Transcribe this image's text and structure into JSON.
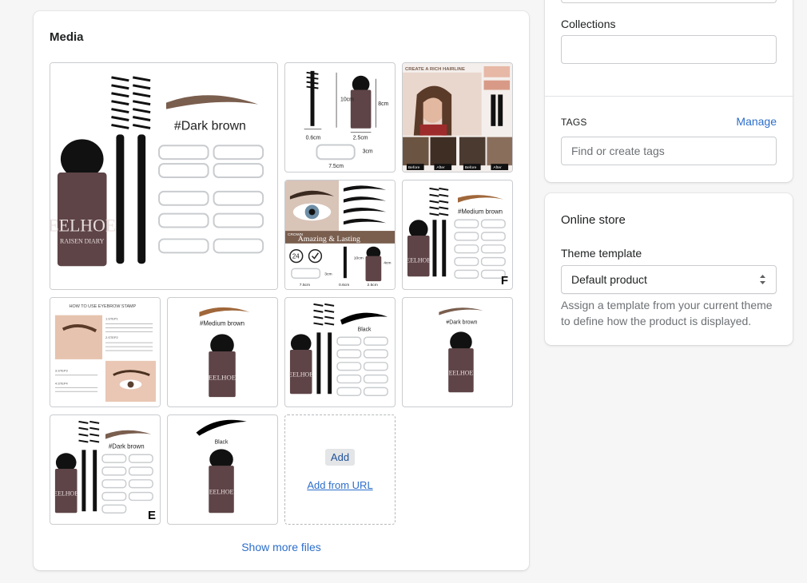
{
  "media": {
    "title": "Media",
    "images": [
      {
        "alt": "Eyebrow stamp kit #Dark brown",
        "label": "#Dark brown",
        "brand": "EELHOE",
        "sub": "RAISEN DIARY"
      },
      {
        "alt": "Product dimensions",
        "dims": [
          "10cm",
          "8cm",
          "0.6cm",
          "2.5cm",
          "3cm",
          "7.5cm"
        ]
      },
      {
        "alt": "Create a rich hairline",
        "heading": "CREATE A RICH HAIRLINE",
        "tags": [
          "Before",
          "After",
          "Before",
          "After"
        ]
      },
      {
        "alt": "Amazing and Lasting",
        "banner": "Amazing & Lasting",
        "small": "CROWN",
        "dims": [
          "10cm",
          "4cm",
          "3cm",
          "7.5cm",
          "0.6cm",
          "2.5cm"
        ],
        "badge": "24"
      },
      {
        "alt": "Eyebrow stamp kit #Medium brown, variant F",
        "label": "#Medium brown",
        "brand": "EELHOE",
        "letter": "F"
      },
      {
        "alt": "How to use eyebrow stamp",
        "heading": "HOW TO USE EYEBROW STAMP",
        "steps": [
          "1.STEP1",
          "2.STEP2",
          "3.STEP3",
          "4.STEP4"
        ]
      },
      {
        "alt": "Eyebrow stamp #Medium brown",
        "label": "#Medium brown",
        "brand": "EELHOE"
      },
      {
        "alt": "Eyebrow stamp kit Black",
        "label": "Black",
        "brand": "EELHOE"
      },
      {
        "alt": "Eyebrow stamp #Dark brown",
        "label": "#Dark brown",
        "brand": "EELHOE"
      },
      {
        "alt": "Eyebrow stamp kit #Dark brown, variant E",
        "label": "#Dark brown",
        "brand": "EELHOE",
        "letter": "E"
      },
      {
        "alt": "Eyebrow stamp Black",
        "label": "Black",
        "brand": "EELHOE"
      }
    ],
    "add_label": "Add",
    "add_url_label": "Add from URL",
    "show_more_label": "Show more files"
  },
  "organization": {
    "collections_label": "Collections",
    "collections_value": "",
    "tags_label": "TAGS",
    "manage_label": "Manage",
    "tags_placeholder": "Find or create tags"
  },
  "online_store": {
    "title": "Online store",
    "theme_label": "Theme template",
    "theme_value": "Default product",
    "help_text": "Assign a template from your current theme to define how the product is displayed."
  },
  "colors": {
    "link": "#2c6ecb",
    "dark_brown": "#7a5e4e",
    "medium_brown": "#a0673a",
    "black_brow": "#000000",
    "stamp_body": "#5e4447"
  }
}
